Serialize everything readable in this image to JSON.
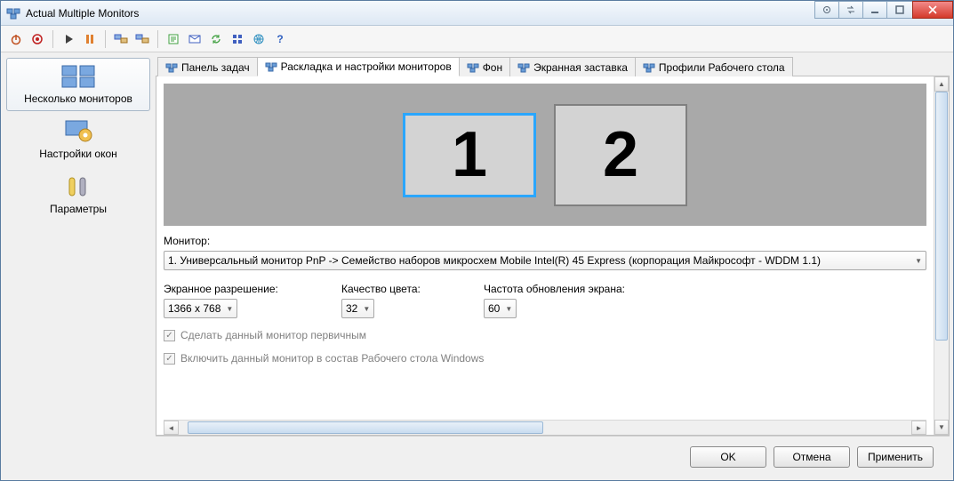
{
  "title": "Actual Multiple Monitors",
  "titlebar_icons": [
    "gear-icon",
    "swap-icon",
    "minimize-icon",
    "maximize-icon",
    "close-icon"
  ],
  "toolbar": [
    {
      "name": "power-icon",
      "color": "#c05020"
    },
    {
      "name": "target-icon",
      "color": "#c02020"
    },
    {
      "sep": true
    },
    {
      "name": "play-icon",
      "color": "#404040"
    },
    {
      "name": "pause-icon",
      "color": "#e08030"
    },
    {
      "sep": true
    },
    {
      "name": "screens-a-icon",
      "color": "#4060c0"
    },
    {
      "name": "screens-b-icon",
      "color": "#4060c0"
    },
    {
      "sep": true
    },
    {
      "name": "note-icon",
      "color": "#40a040"
    },
    {
      "name": "mail-icon",
      "color": "#4060c0"
    },
    {
      "name": "refresh-icon",
      "color": "#40a040"
    },
    {
      "name": "grid-icon",
      "color": "#4060c0"
    },
    {
      "name": "globe-icon",
      "color": "#3090c0"
    },
    {
      "name": "help-icon",
      "color": "#3060c0"
    }
  ],
  "sidebar": {
    "items": [
      {
        "label": "Несколько мониторов",
        "selected": true,
        "icon": "multi-monitors-icon"
      },
      {
        "label": "Настройки окон",
        "selected": false,
        "icon": "window-gear-icon"
      },
      {
        "label": "Параметры",
        "selected": false,
        "icon": "tools-icon"
      }
    ]
  },
  "tabs": [
    {
      "label": "Панель задач",
      "active": false,
      "icon": "taskbar-icon"
    },
    {
      "label": "Раскладка и настройки мониторов",
      "active": true,
      "icon": "layout-icon"
    },
    {
      "label": "Фон",
      "active": false,
      "icon": "background-icon"
    },
    {
      "label": "Экранная заставка",
      "active": false,
      "icon": "screensaver-icon"
    },
    {
      "label": "Профили Рабочего стола",
      "active": false,
      "icon": "profiles-icon"
    }
  ],
  "monitors": [
    {
      "num": "1",
      "selected": true
    },
    {
      "num": "2",
      "selected": false
    }
  ],
  "monitor_section": {
    "label": "Монитор:",
    "value": "1. Универсальный монитор PnP -> Семейство наборов микросхем Mobile Intel(R) 45 Express (корпорация Майкрософт - WDDM 1.1)"
  },
  "settings": {
    "resolution": {
      "label": "Экранное разрешение:",
      "value": "1366 x 768"
    },
    "color": {
      "label": "Качество цвета:",
      "value": "32"
    },
    "refresh": {
      "label": "Частота обновления экрана:",
      "value": "60"
    }
  },
  "checks": {
    "primary": {
      "label": "Сделать данный монитор первичным",
      "checked": true,
      "disabled": true
    },
    "include": {
      "label": "Включить данный монитор в состав Рабочего стола Windows",
      "checked": true,
      "disabled": true
    }
  },
  "buttons": {
    "ok": "OK",
    "cancel": "Отмена",
    "apply": "Применить"
  }
}
